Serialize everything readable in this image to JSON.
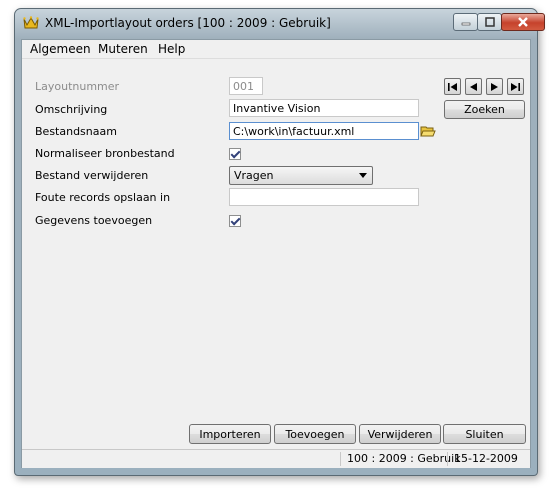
{
  "window": {
    "title": "XML-Importlayout orders  [100 : 2009 : Gebruik]"
  },
  "menu": {
    "items": [
      "Algemeen",
      "Muteren",
      "Help"
    ]
  },
  "form": {
    "layoutnummer": {
      "label": "Layoutnummer",
      "value": "001"
    },
    "omschrijving": {
      "label": "Omschrijving",
      "value": "Invantive Vision"
    },
    "bestandsnaam": {
      "label": "Bestandsnaam",
      "value": "C:\\work\\in\\factuur.xml"
    },
    "normaliseer": {
      "label": "Normaliseer bronbestand",
      "checked": true
    },
    "verwijderen": {
      "label": "Bestand verwijderen",
      "value": "Vragen"
    },
    "foute_records": {
      "label": "Foute records opslaan in",
      "value": ""
    },
    "gegevens_toevoegen": {
      "label": "Gegevens toevoegen",
      "checked": true
    }
  },
  "buttons": {
    "zoeken": "Zoeken",
    "importeren": "Importeren",
    "toevoegen": "Toevoegen",
    "verwijderen": "Verwijderen",
    "sluiten": "Sluiten"
  },
  "status": {
    "context": "100 : 2009 : Gebruik",
    "date": "15-12-2009"
  },
  "icons": {
    "app": "crown-icon",
    "folder": "open-folder-icon",
    "nav": [
      "first-record-icon",
      "previous-record-icon",
      "next-record-icon",
      "last-record-icon"
    ]
  },
  "colors": {
    "close_button": "#c6422c",
    "checkmark": "#33427a"
  }
}
